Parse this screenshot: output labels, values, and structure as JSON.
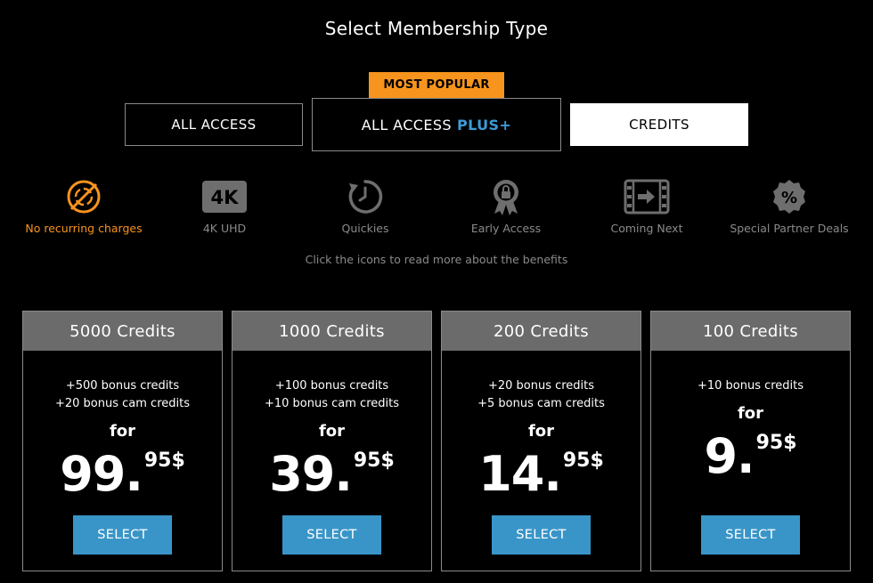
{
  "page_title": "Select Membership Type",
  "badge": "MOST POPULAR",
  "tabs": {
    "all_access": "ALL ACCESS",
    "plus_main": "ALL ACCESS",
    "plus_suffix": "PLUS+",
    "credits": "CREDITS"
  },
  "benefits": [
    {
      "label": "No recurring charges",
      "icon": "no-recurring-icon",
      "active": true
    },
    {
      "label": "4K UHD",
      "icon": "4k-icon"
    },
    {
      "label": "Quickies",
      "icon": "quickies-icon"
    },
    {
      "label": "Early Access",
      "icon": "early-access-icon"
    },
    {
      "label": "Coming Next",
      "icon": "coming-next-icon"
    },
    {
      "label": "Special Partner Deals",
      "icon": "partner-deals-icon"
    }
  ],
  "icon_text": {
    "uhd": "4K",
    "percent": "%"
  },
  "hint": "Click the icons to read more about the benefits",
  "colors": {
    "accent_orange": "#f7941d",
    "accent_blue": "#3b9bd6",
    "button_blue": "#3995c8",
    "card_header": "#6b6b6b"
  },
  "cards": [
    {
      "title": "5000 Credits",
      "bonus1": "+500 bonus credits",
      "bonus2": "+20 bonus cam credits",
      "for": "for",
      "price_main": "99.",
      "price_cents": "95$",
      "button": "SELECT"
    },
    {
      "title": "1000 Credits",
      "bonus1": "+100 bonus credits",
      "bonus2": "+10 bonus cam credits",
      "for": "for",
      "price_main": "39.",
      "price_cents": "95$",
      "button": "SELECT"
    },
    {
      "title": "200 Credits",
      "bonus1": "+20 bonus credits",
      "bonus2": "+5 bonus cam credits",
      "for": "for",
      "price_main": "14.",
      "price_cents": "95$",
      "button": "SELECT"
    },
    {
      "title": "100 Credits",
      "bonus1": "+10 bonus credits",
      "for": "for",
      "price_main": "9.",
      "price_cents": "95$",
      "button": "SELECT"
    }
  ]
}
